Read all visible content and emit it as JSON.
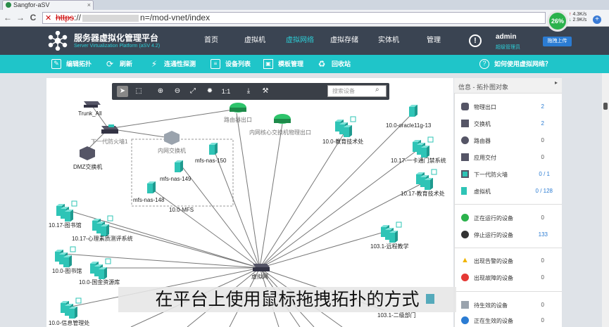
{
  "browser": {
    "tab_title": "Sangfor-aSV",
    "tab_close": "×",
    "back": "←",
    "forward": "→",
    "reload": "C",
    "url_scheme": "https",
    "url_path": "n=/mod-vnet/index",
    "percent": "26%",
    "net_up": "4.3K/s",
    "net_down": "2.9K/s",
    "plus": "+"
  },
  "header": {
    "brand_cn": "服务器虚拟化管理平台",
    "brand_en": "Server Virtualization Platform (aSV 4.2)",
    "nav": [
      "首页",
      "虚拟机",
      "虚拟网络",
      "虚拟存储",
      "实体机",
      "管理"
    ],
    "active_nav": "虚拟网络",
    "help": "!",
    "user": "admin",
    "role": "超级管理员",
    "upload_label": "拖拽上传"
  },
  "toolbar": {
    "edit": "编辑拓扑",
    "refresh": "刷新",
    "probe": "连通性探测",
    "device_list": "设备列表",
    "template": "模板管理",
    "recycle": "回收站",
    "help": "如何使用虚拟网络？"
  },
  "float_toolbar": {
    "zoom_reset": "1:1",
    "search_placeholder": "搜索设备"
  },
  "topology": {
    "labels": {
      "trunk_all": "Trunk_All",
      "router_out": "路由器出口",
      "core_switch": "内网核心交换机物理出口",
      "fw": "下一代防火墙1",
      "inner_switch": "内网交换机",
      "dmz": "DMZ交换机",
      "nas150": "mfs-nas-150",
      "nas149": "mfs-nas-149",
      "nas148": "mfs-nas-148",
      "mfs_group": "10.0-MFS",
      "oracle": "10.0-oracle11g-13",
      "edu_tech": "10.0-教育技术处",
      "card_door": "10.17-一卡通门禁系统",
      "edu_tech17": "10.17-教育技术处",
      "library": "10.17-图书馆",
      "psych": "10.17-心理素质测评系统",
      "lib10": "10.0-图书馆",
      "assets": "10.0-国金资源库",
      "remote_edu": "103.1-远程教学",
      "second_dept": "103.1-二级部门",
      "bottom_left": "10.0-信息管理处",
      "center": "虚拟网"
    },
    "badges": {
      "lib": "16",
      "lib10": "14",
      "bottom": "10",
      "remote": "9",
      "edu": "2"
    }
  },
  "panel": {
    "title": "信息 - 拓扑图对象",
    "collapse": "▸",
    "rows": [
      {
        "label": "物理出口",
        "value": "2"
      },
      {
        "label": "交换机",
        "value": "2"
      },
      {
        "label": "路由器",
        "value": "0"
      },
      {
        "label": "应用交付",
        "value": "0"
      },
      {
        "label": "下一代防火墙",
        "value": "0 / 1"
      },
      {
        "label": "虚拟机",
        "value": "0 / 128"
      }
    ],
    "status_rows": [
      {
        "label": "正在运行的设备",
        "value": "0"
      },
      {
        "label": "停止运行的设备",
        "value": "133"
      }
    ],
    "alert_rows": [
      {
        "label": "出现告警的设备",
        "value": "0"
      },
      {
        "label": "出现故障的设备",
        "value": "0"
      }
    ],
    "pending_rows": [
      {
        "label": "待生效的设备",
        "value": "0"
      },
      {
        "label": "正在生效的设备",
        "value": "0"
      }
    ]
  },
  "subtitle": "在平台上使用鼠标拖拽拓扑的方式",
  "colors": {
    "header_bg": "#3a4452",
    "toolbar_teal": "#1fc5c9",
    "accent_blue": "#2b7cd3",
    "vm_teal": "#2ec4b6"
  }
}
